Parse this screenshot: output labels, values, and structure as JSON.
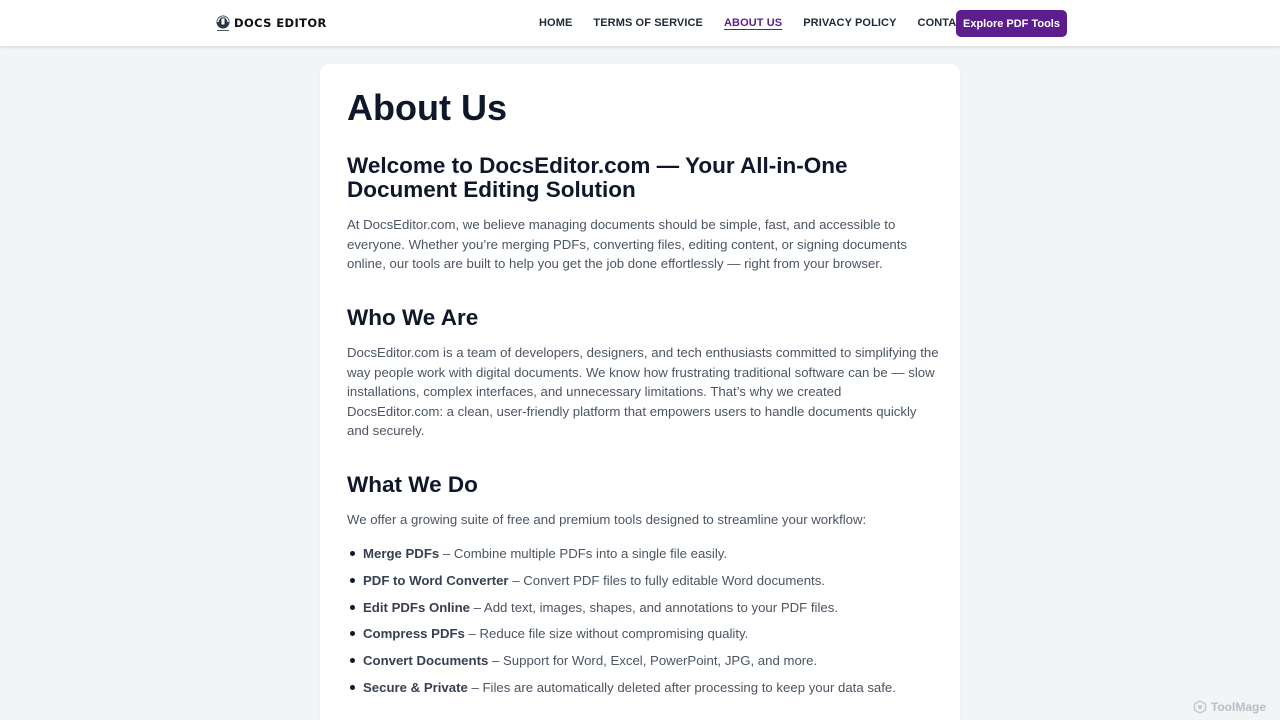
{
  "header": {
    "logo_text": "DOCS EDITOR",
    "nav": [
      {
        "label": "HOME",
        "active": false
      },
      {
        "label": "TERMS OF SERVICE",
        "active": false
      },
      {
        "label": "ABOUT US",
        "active": true
      },
      {
        "label": "PRIVACY POLICY",
        "active": false
      },
      {
        "label": "CONTACT US",
        "active": false
      }
    ],
    "cta_label": "Explore PDF Tools"
  },
  "content": {
    "title": "About Us",
    "welcome": {
      "heading": "Welcome to DocsEditor.com — Your All-in-One Document Editing Solution",
      "body": "At DocsEditor.com, we believe managing documents should be simple, fast, and accessible to everyone. Whether you’re merging PDFs, converting files, editing content, or signing documents online, our tools are built to help you get the job done effortlessly — right from your browser."
    },
    "who": {
      "heading": "Who We Are",
      "body": "DocsEditor.com is a team of developers, designers, and tech enthusiasts committed to simplifying the way people work with digital documents. We know how frustrating traditional software can be — slow installations, complex interfaces, and unnecessary limitations. That’s why we created DocsEditor.com: a clean, user-friendly platform that empowers users to handle documents quickly and securely."
    },
    "what": {
      "heading": "What We Do",
      "intro": "We offer a growing suite of free and premium tools designed to streamline your workflow:",
      "features": [
        {
          "name": "Merge PDFs",
          "desc": " – Combine multiple PDFs into a single file easily."
        },
        {
          "name": "PDF to Word Converter",
          "desc": " – Convert PDF files to fully editable Word documents."
        },
        {
          "name": "Edit PDFs Online",
          "desc": " – Add text, images, shapes, and annotations to your PDF files."
        },
        {
          "name": "Compress PDFs",
          "desc": " – Reduce file size without compromising quality."
        },
        {
          "name": "Convert Documents",
          "desc": " – Support for Word, Excel, PowerPoint, JPG, and more."
        },
        {
          "name": "Secure & Private",
          "desc": " – Files are automatically deleted after processing to keep your data safe."
        }
      ]
    }
  },
  "watermark": "ToolMage",
  "colors": {
    "accent": "#5b1e8c",
    "background": "#f3f4f6",
    "heading": "#0f172a",
    "body_text": "#4b5563"
  }
}
